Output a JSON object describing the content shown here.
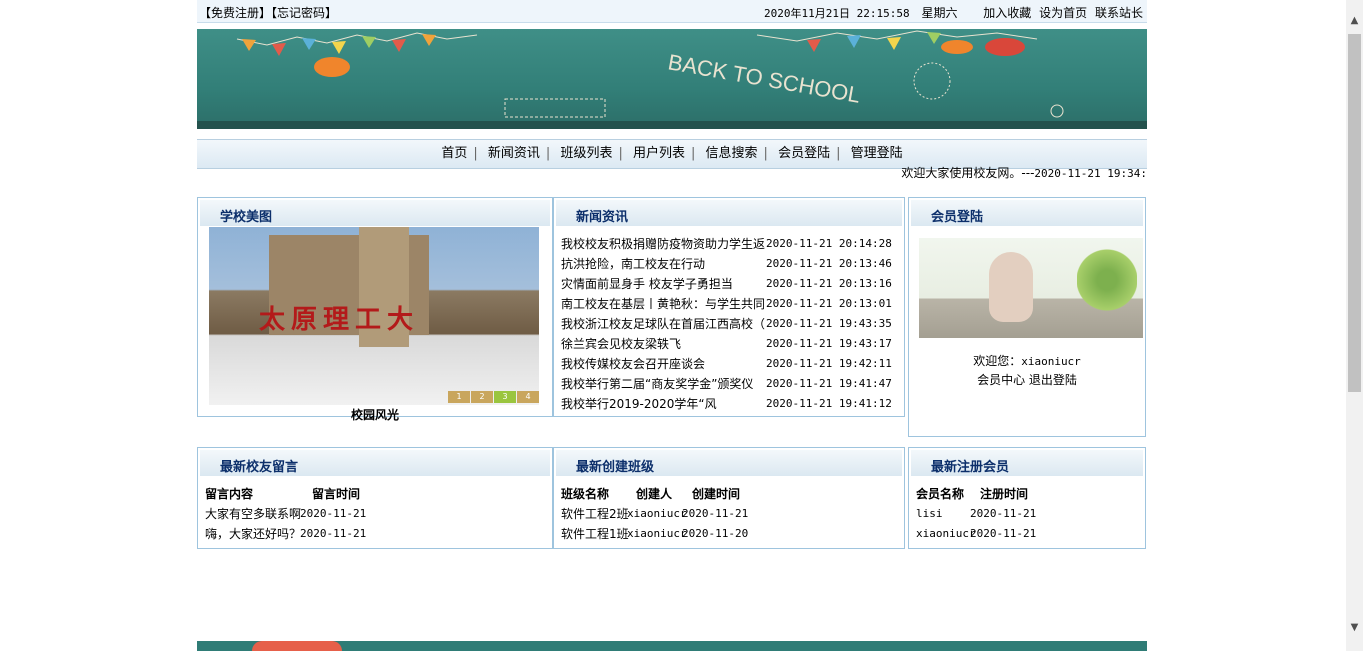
{
  "topbar": {
    "register": "【免费注册】",
    "forgot": "【忘记密码】",
    "datetime": "2020年11月21日 22:15:58",
    "weekday": "星期六",
    "favorite": "加入收藏",
    "homepage": "设为首页",
    "contact": "联系站长"
  },
  "nav": {
    "items": [
      "首页",
      "新闻资讯",
      "班级列表",
      "用户列表",
      "信息搜索",
      "会员登陆",
      "管理登陆"
    ]
  },
  "marquee": {
    "text": "欢迎大家使用校友网。---",
    "time": "2020-11-21 19:34:"
  },
  "school_photos": {
    "title": "学校美图",
    "sign_text": "太原理工大",
    "pager": [
      "1",
      "2",
      "3",
      "4"
    ],
    "caption": "校园风光"
  },
  "news": {
    "title": "新闻资讯",
    "items": [
      {
        "title": "我校校友积极捐赠防疫物资助力学生返",
        "date": "2020-11-21 20:14:28"
      },
      {
        "title": "抗洪抢险，南工校友在行动",
        "date": "2020-11-21 20:13:46"
      },
      {
        "title": "灾情面前显身手 校友学子勇担当",
        "date": "2020-11-21 20:13:16"
      },
      {
        "title": "南工校友在基层丨黄艳秋：与学生共同",
        "date": "2020-11-21 20:13:01"
      },
      {
        "title": "我校浙江校友足球队在首届江西高校（",
        "date": "2020-11-21 19:43:35"
      },
      {
        "title": "徐兰宾会见校友梁轶飞",
        "date": "2020-11-21 19:43:17"
      },
      {
        "title": "我校传媒校友会召开座谈会",
        "date": "2020-11-21 19:42:11"
      },
      {
        "title": "我校举行第二届“商友奖学金”颁奖仪",
        "date": "2020-11-21 19:41:47"
      },
      {
        "title": "我校举行2019-2020学年“风",
        "date": "2020-11-21 19:41:12"
      }
    ]
  },
  "member_login": {
    "title": "会员登陆",
    "welcome_label": "欢迎您：",
    "username": "xiaoniucr",
    "center": "会员中心",
    "logout": "退出登陆"
  },
  "messages": {
    "title": "最新校友留言",
    "headers": [
      "留言内容",
      "留言时间"
    ],
    "rows": [
      {
        "content": "大家有空多联系啊",
        "time": "2020-11-21"
      },
      {
        "content": "嗨，大家还好吗？",
        "time": "2020-11-21"
      }
    ]
  },
  "classes": {
    "title": "最新创建班级",
    "headers": [
      "班级名称",
      "创建人",
      "创建时间"
    ],
    "rows": [
      {
        "name": "软件工程2班",
        "creator": "xiaoniucr",
        "time": "2020-11-21"
      },
      {
        "name": "软件工程1班",
        "creator": "xiaoniucr",
        "time": "2020-11-20"
      }
    ]
  },
  "members": {
    "title": "最新注册会员",
    "headers": [
      "会员名称",
      "注册时间"
    ],
    "rows": [
      {
        "name": "lisi",
        "time": "2020-11-21"
      },
      {
        "name": "xiaoniucr",
        "time": "2020-11-21"
      }
    ]
  },
  "colors": {
    "header_text": "#0c2f6b",
    "border": "#9ec4de",
    "banner": "#3f8f87"
  }
}
